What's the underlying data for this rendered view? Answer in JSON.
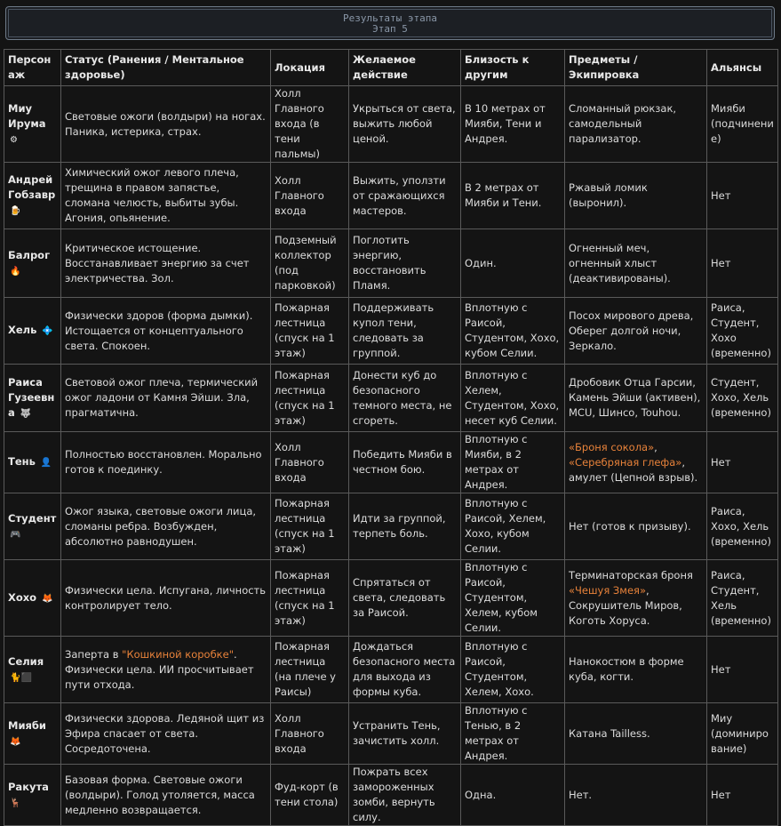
{
  "header": {
    "title": "Результаты этапа",
    "subtitle": "Этап 5"
  },
  "colors": {
    "highlight": "#e8823a",
    "border": "#5a5a5a",
    "background": "#141414"
  },
  "columns": [
    "Персонаж",
    "Статус (Ранения / Ментальное здоровье)",
    "Локация",
    "Желаемое действие",
    "Близость к другим",
    "Предметы / Экипировка",
    "Альянсы"
  ],
  "rows": [
    {
      "name": "Миу Ирума",
      "icon": "⚙",
      "status": "Световые ожоги (волдыри) на ногах. Паника, истерика, страх.",
      "location": "Холл Главного входа (в тени пальмы)",
      "action": "Укрыться от света, выжить любой ценой.",
      "proximity": "В 10 метрах от Мияби, Тени и Андрея.",
      "items": "Сломанный рюкзак, самодельный парализатор.",
      "alliance": "Мияби (подчинение)"
    },
    {
      "name": "Андрей Гобзавр",
      "icon": "🍺",
      "status": "Химический ожог левого плеча, трещина в правом запястье, сломана челюсть, выбиты зубы. Агония, опьянение.",
      "location": "Холл Главного входа",
      "action": "Выжить, уползти от сражающихся мастеров.",
      "proximity": "В 2 метрах от Мияби и Тени.",
      "items": "Ржавый ломик (выронил).",
      "alliance": "Нет"
    },
    {
      "name": "Балрог",
      "icon": "🔥",
      "status": "Критическое истощение. Восстанавливает энергию за счет электричества. Зол.",
      "location": "Подземный коллектор (под парковкой)",
      "action": "Поглотить энергию, восстановить Пламя.",
      "proximity": "Один.",
      "items": "Огненный меч, огненный хлыст (деактивированы).",
      "alliance": "Нет"
    },
    {
      "name": "Хель",
      "icon": "💠",
      "status": "Физически здоров (форма дымки). Истощается от концептуального света. Спокоен.",
      "location": "Пожарная лестница (спуск на 1 этаж)",
      "action": "Поддерживать купол тени, следовать за группой.",
      "proximity": "Вплотную с Раисой, Студентом, Хохо, кубом Селии.",
      "items": "Посох мирового древа, Оберег долгой ночи, Зеркало.",
      "alliance": "Раиса, Студент, Хохо (временно)"
    },
    {
      "name": "Раиса Гузеевна",
      "icon": "🐺",
      "status": "Световой ожог плеча, термический ожог ладони от Камня Эйши. Зла, прагматична.",
      "location": "Пожарная лестница (спуск на 1 этаж)",
      "action": "Донести куб до безопасного темного места, не сгореть.",
      "proximity": "Вплотную с Хелем, Студентом, Хохо, несет куб Селии.",
      "items": "Дробовик Отца Гарсии, Камень Эйши (активен), MCU, Шинсо, Touhou.",
      "alliance": "Студент, Хохо, Хель (временно)"
    },
    {
      "name": "Тень",
      "icon": "👤",
      "status": "Полностью восстановлен. Морально готов к поединку.",
      "location": "Холл Главного входа",
      "action": "Победить Мияби в честном бою.",
      "proximity": "Вплотную с Мияби, в 2 метрах от Андрея.",
      "items_hl1": "«Броня сокола»",
      "items_sep": ",",
      "items_hl2": "«Серебряная глефа»",
      "items_tail": ", амулет (Цепной взрыв).",
      "alliance": "Нет"
    },
    {
      "name": "Студент",
      "icon": "🎮",
      "status": "Ожог языка, световые ожоги лица, сломаны ребра. Возбужден, абсолютно равнодушен.",
      "location": "Пожарная лестница (спуск на 1 этаж)",
      "action": "Идти за группой, терпеть боль.",
      "proximity": "Вплотную с Раисой, Хелем, Хохо, кубом Селии.",
      "items": "Нет (готов к призыву).",
      "alliance": "Раиса, Хохо, Хель (временно)"
    },
    {
      "name": "Хохо",
      "icon": "🦊",
      "status": "Физически цела. Испугана, личность контролирует тело.",
      "location": "Пожарная лестница (спуск на 1 этаж)",
      "action": "Спрятаться от света, следовать за Раисой.",
      "proximity": "Вплотную с Раисой, Студентом, Хелем, кубом Селии.",
      "items_pre": "Терминаторская броня ",
      "items_hl": "«Чешуя Змея»",
      "items_tail": ", Сокрушитель Миров, Коготь Хоруса.",
      "alliance": "Раиса, Студент, Хель (временно)"
    },
    {
      "name": "Селия",
      "icon": "🐈⬛",
      "status_pre": "Заперта в ",
      "status_hl": "\"Кошкиной коробке\"",
      "status_tail": ". Физически цела. ИИ просчитывает пути отхода.",
      "location": "Пожарная лестница (на плече у Раисы)",
      "action": "Дождаться безопасного места для выхода из формы куба.",
      "proximity": "Вплотную с Раисой, Студентом, Хелем, Хохо.",
      "items": "Нанокостюм в форме куба, когти.",
      "alliance": "Нет"
    },
    {
      "name": "Мияби",
      "icon": "🦊",
      "status": "Физически здорова. Ледяной щит из Эфира спасает от света. Сосредоточена.",
      "location": "Холл Главного входа",
      "action": "Устранить Тень, зачистить холл.",
      "proximity": "Вплотную с Тенью, в 2 метрах от Андрея.",
      "items": "Катана Tailless.",
      "alliance": "Миу (доминирование)"
    },
    {
      "name": "Ракута",
      "icon": "🦌",
      "status": "Базовая форма. Световые ожоги (волдыри). Голод утоляется, масса медленно возвращается.",
      "location": "Фуд-корт (в тени стола)",
      "action": "Пожрать всех замороженных зомби, вернуть силу.",
      "proximity": "Одна.",
      "items": "Нет.",
      "alliance": "Нет"
    }
  ]
}
